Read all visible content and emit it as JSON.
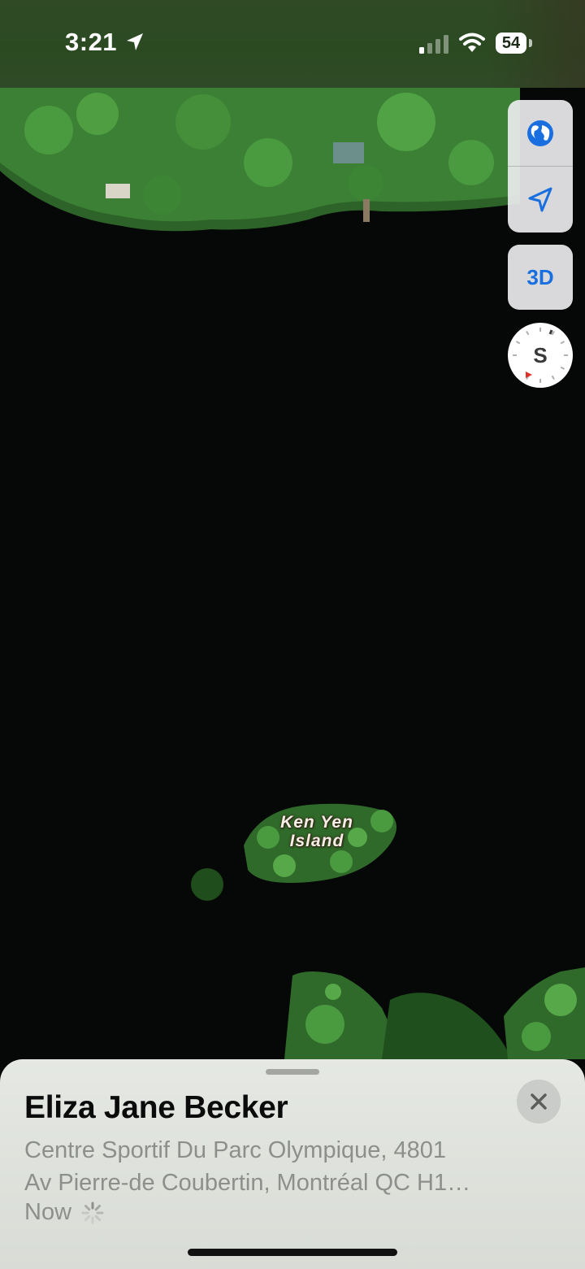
{
  "status_bar": {
    "time": "3:21",
    "battery_level": "54",
    "signal_bars_active": 1,
    "signal_bars_total": 4,
    "icons": [
      "location-arrow-icon",
      "cellular-signal-icon",
      "wifi-icon",
      "battery-icon"
    ]
  },
  "map": {
    "type": "satellite",
    "place_label_line1": "Ken Yen",
    "place_label_line2": "Island",
    "colors": {
      "water": "#050806",
      "forest": "#2f6a2a",
      "canopy": "#3f8a36"
    }
  },
  "controls": {
    "globe_icon": "globe-icon",
    "location_icon": "location-arrow-icon",
    "three_d_label": "3D",
    "compass_heading": "S",
    "accent": "#1a6fe0"
  },
  "sheet": {
    "title": "Eliza Jane Becker",
    "address_line1": "Centre Sportif Du Parc Olympique, 4801",
    "address_line2": "Av Pierre-de Coubertin, Montréal QC H1…",
    "updated": "Now",
    "close_icon": "close-icon",
    "spinner_icon": "loading-spinner-icon"
  }
}
